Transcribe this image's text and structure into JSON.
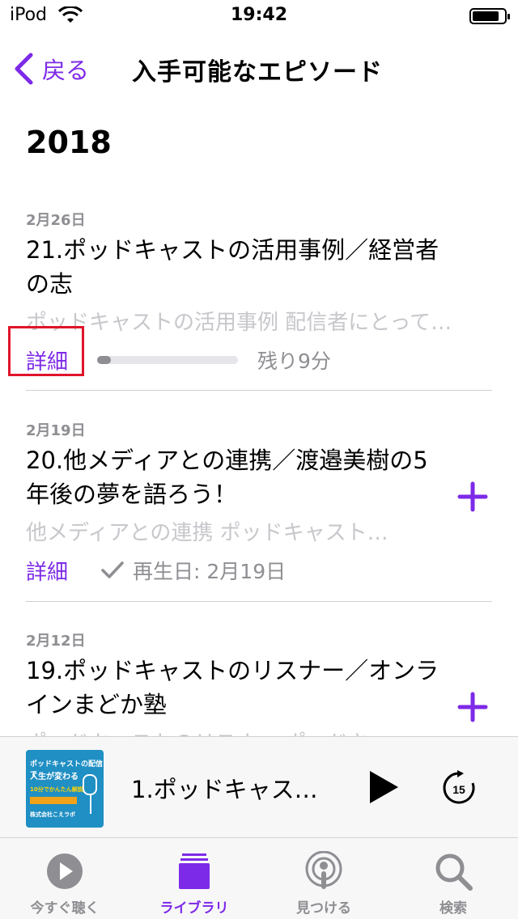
{
  "status_bar": {
    "carrier": "iPod",
    "time": "19:42"
  },
  "nav": {
    "back_label": "戻る",
    "title": "入手可能なエピソード"
  },
  "section": {
    "year": "2018"
  },
  "episodes": [
    {
      "date": "2月26日",
      "title": "21.ポッドキャストの活用事例／経営者の志",
      "description": "ポッドキャストの活用事例 配信者にとって…",
      "details_label": "詳細",
      "progress": 0.1,
      "remaining": "残り9分"
    },
    {
      "date": "2月19日",
      "title": "20.他メディアとの連携／渡邉美樹の5年後の夢を語ろう！",
      "description": "他メディアとの連携 ポッドキャスト…",
      "details_label": "詳細",
      "played": "再生日: 2月19日"
    },
    {
      "date": "2月12日",
      "title": "19.ポッドキャストのリスナー／オンラインまどか塾",
      "description": "ポッドキャストのリスナー ポッドキ…"
    }
  ],
  "player": {
    "artwork": {
      "line1": "ポッドキャストの配信で",
      "line2": "人生が変わる",
      "line3": "10分でかんたん解説",
      "line4": "株式会社こえラボ"
    },
    "title": "1.ポッドキャス…",
    "skip_seconds": "15"
  },
  "tabs": [
    {
      "label": "今すぐ聴く",
      "icon": "play-circle-icon"
    },
    {
      "label": "ライブラリ",
      "icon": "library-icon",
      "active": true
    },
    {
      "label": "見つける",
      "icon": "podcast-icon"
    },
    {
      "label": "検索",
      "icon": "search-icon"
    }
  ],
  "colors": {
    "accent": "#7d2ae8",
    "highlight": "#e0142a",
    "secondary": "#8e8e93"
  }
}
